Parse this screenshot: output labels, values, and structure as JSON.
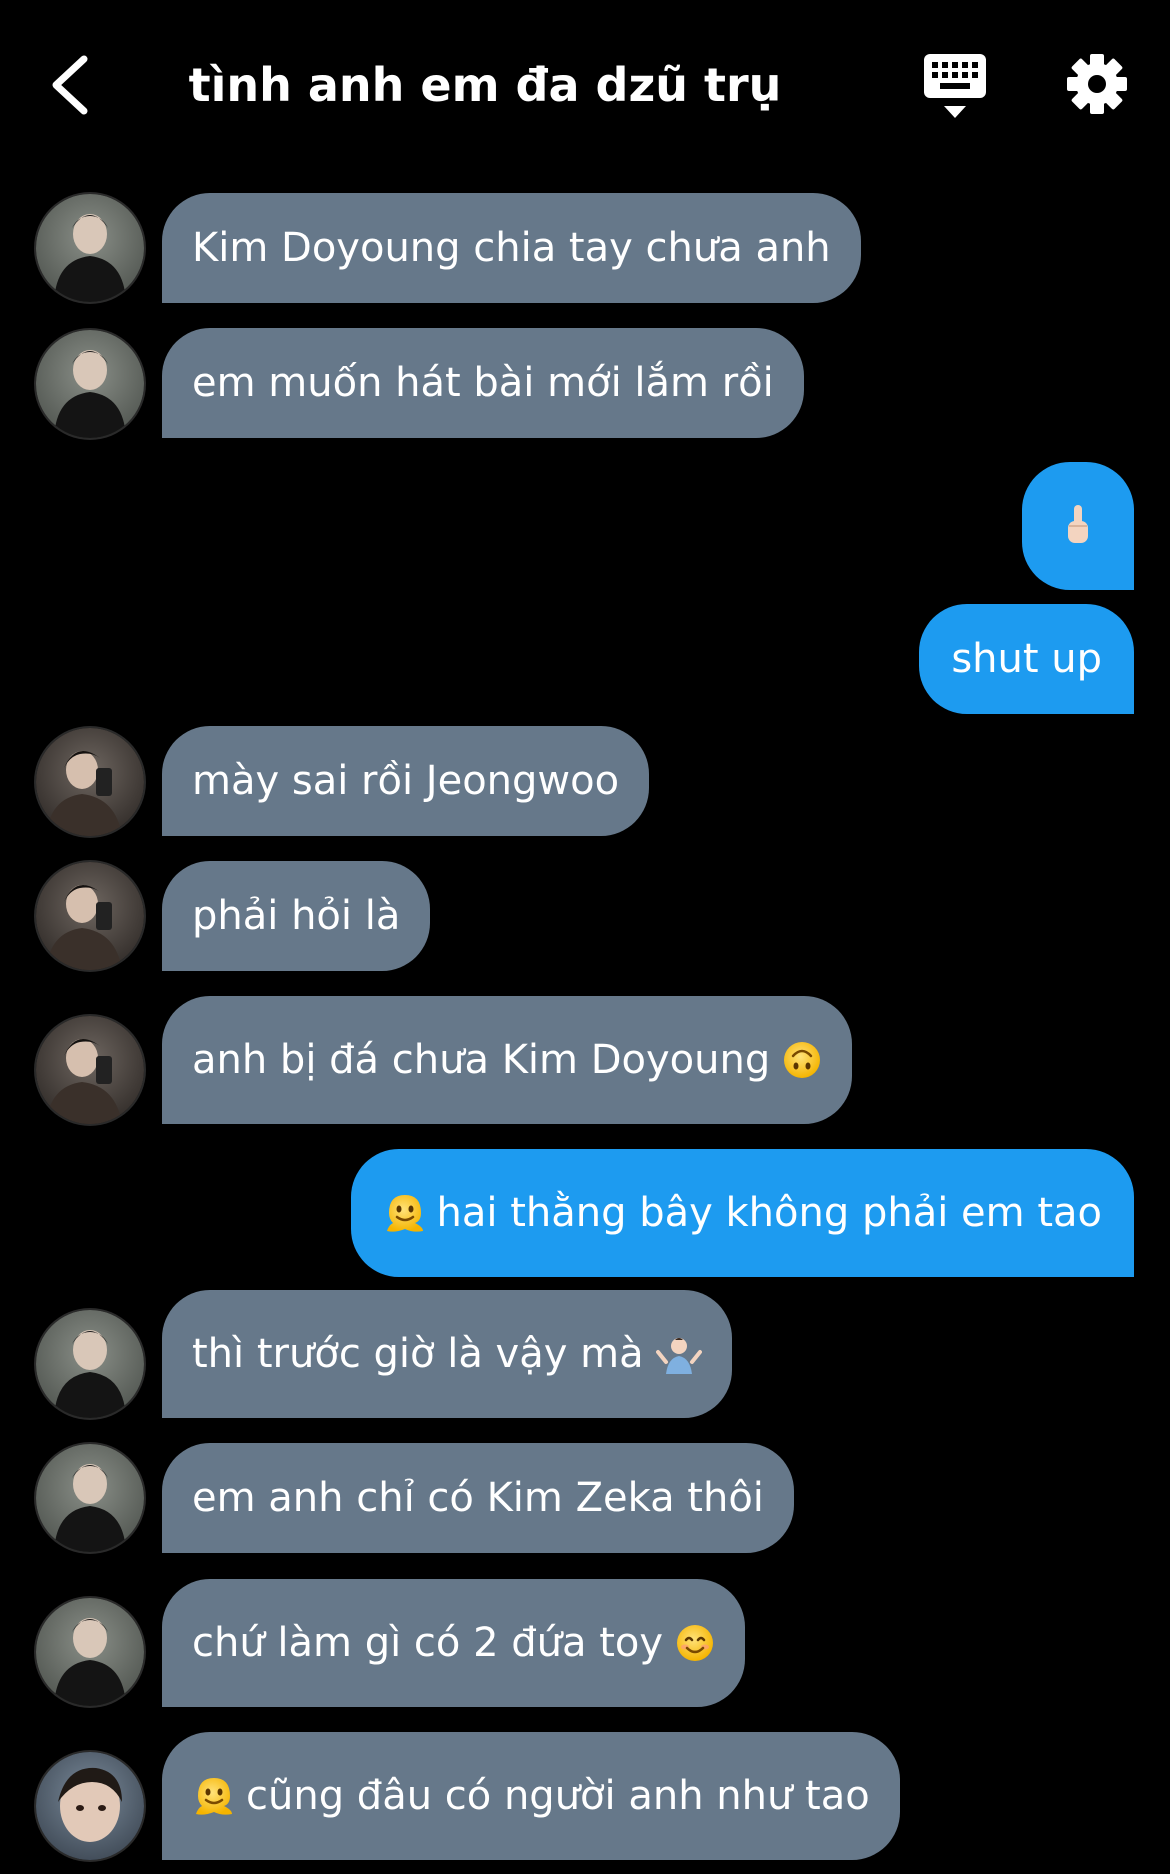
{
  "header": {
    "title": "tình anh em đa dzũ trụ",
    "back_icon": "chevron-left-icon",
    "keyboard_icon": "keyboard-icon",
    "settings_icon": "gear-icon"
  },
  "colors": {
    "background": "#000000",
    "incoming_bubble": "#66788a",
    "outgoing_bubble": "#1d9bf0"
  },
  "messages": [
    {
      "side": "in",
      "text": "Kim Doyoung chia tay chưa anh",
      "avatar": "avatar-leather-jacket"
    },
    {
      "side": "in",
      "text": "em muốn hát bài mới lắm rồi",
      "avatar": "avatar-leather-jacket"
    },
    {
      "side": "out",
      "emoji": "pointing-up-hand-emoji"
    },
    {
      "side": "out",
      "text": "shut up"
    },
    {
      "side": "in",
      "text": "mày sai rồi Jeongwoo",
      "avatar": "avatar-mirror-selfie"
    },
    {
      "side": "in",
      "text": "phải hỏi là",
      "avatar": "avatar-mirror-selfie"
    },
    {
      "side": "in",
      "text": "anh bị đá chưa Kim Doyoung",
      "emoji": "upside-down-face-emoji",
      "avatar": "avatar-mirror-selfie"
    },
    {
      "side": "out",
      "text": "hai thằng bây không phải em tao",
      "emoji_before": "melting-face-emoji"
    },
    {
      "side": "in",
      "text": "thì trước giờ là vậy mà",
      "emoji": "shrug-emoji",
      "avatar": "avatar-leather-jacket"
    },
    {
      "side": "in",
      "text": "em anh chỉ có Kim Zeka thôi",
      "avatar": "avatar-leather-jacket"
    },
    {
      "side": "in",
      "text": "chứ làm gì có 2 đứa toy",
      "emoji": "smiling-face-emoji",
      "avatar": "avatar-leather-jacket"
    },
    {
      "side": "in",
      "text": "cũng đâu có người anh như tao",
      "emoji_before": "melting-face-emoji",
      "avatar": "avatar-close-up"
    }
  ]
}
